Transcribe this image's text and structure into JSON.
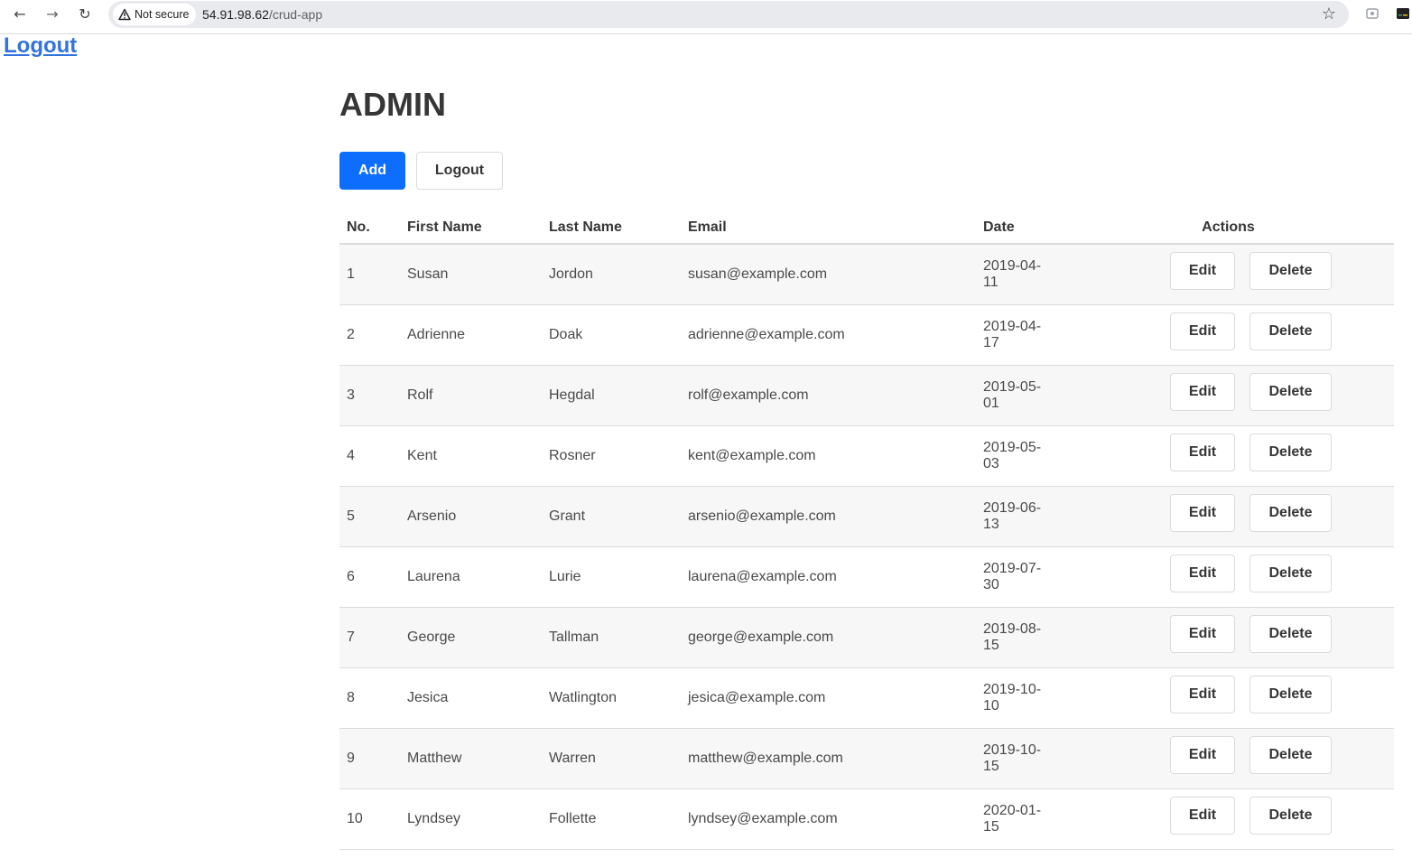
{
  "browser": {
    "security_label": "Not secure",
    "url_host": "54.91.98.62",
    "url_path": "/crud-app"
  },
  "page": {
    "logout_link": "Logout",
    "title": "ADMIN",
    "add_button": "Add",
    "logout_button": "Logout"
  },
  "table": {
    "headers": {
      "no": "No.",
      "first_name": "First Name",
      "last_name": "Last Name",
      "email": "Email",
      "date": "Date",
      "actions": "Actions"
    },
    "edit_label": "Edit",
    "delete_label": "Delete",
    "rows": [
      {
        "no": "1",
        "first": "Susan",
        "last": "Jordon",
        "email": "susan@example.com",
        "date": "2019-04-11"
      },
      {
        "no": "2",
        "first": "Adrienne",
        "last": "Doak",
        "email": "adrienne@example.com",
        "date": "2019-04-17"
      },
      {
        "no": "3",
        "first": "Rolf",
        "last": "Hegdal",
        "email": "rolf@example.com",
        "date": "2019-05-01"
      },
      {
        "no": "4",
        "first": "Kent",
        "last": "Rosner",
        "email": "kent@example.com",
        "date": "2019-05-03"
      },
      {
        "no": "5",
        "first": "Arsenio",
        "last": "Grant",
        "email": "arsenio@example.com",
        "date": "2019-06-13"
      },
      {
        "no": "6",
        "first": "Laurena",
        "last": "Lurie",
        "email": "laurena@example.com",
        "date": "2019-07-30"
      },
      {
        "no": "7",
        "first": "George",
        "last": "Tallman",
        "email": "george@example.com",
        "date": "2019-08-15"
      },
      {
        "no": "8",
        "first": "Jesica",
        "last": "Watlington",
        "email": "jesica@example.com",
        "date": "2019-10-10"
      },
      {
        "no": "9",
        "first": "Matthew",
        "last": "Warren",
        "email": "matthew@example.com",
        "date": "2019-10-15"
      },
      {
        "no": "10",
        "first": "Lyndsey",
        "last": "Follette",
        "email": "lyndsey@example.com",
        "date": "2020-01-15"
      }
    ]
  },
  "colors": {
    "primary": "#0d6efd",
    "link": "#3273dc",
    "stripe": "#f7f7f7"
  }
}
